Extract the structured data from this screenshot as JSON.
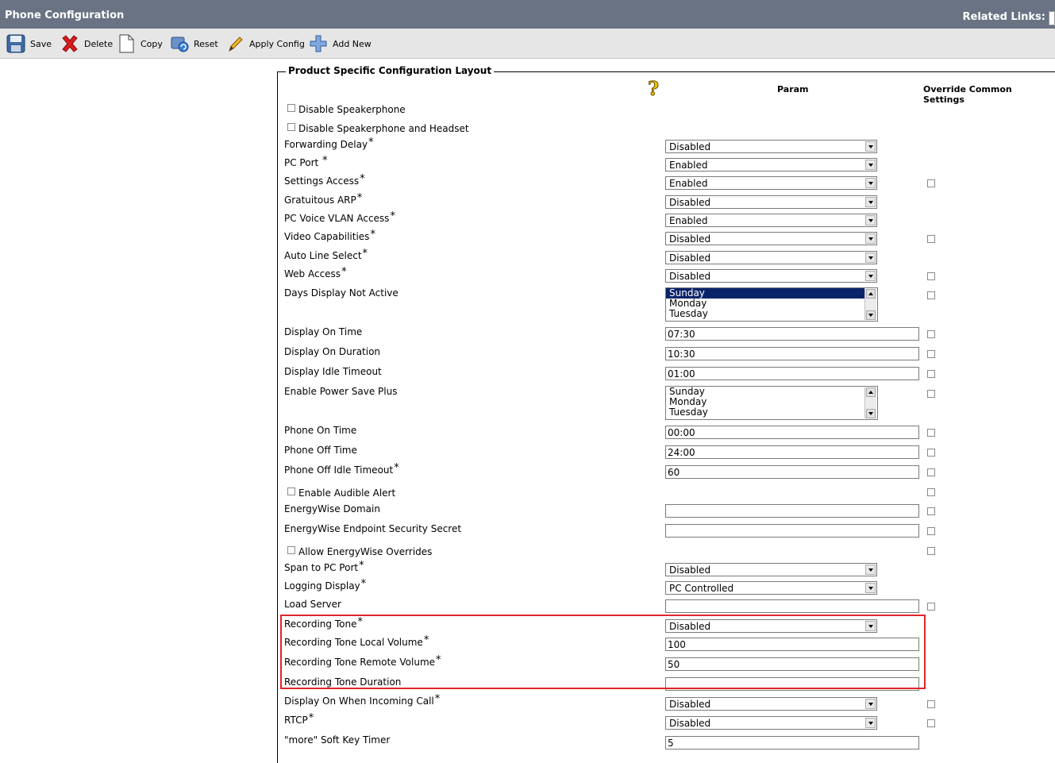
{
  "window": {
    "title": "Phone Configuration",
    "related_links": "Related Links:"
  },
  "toolbar": {
    "save": "Save",
    "delete": "Delete",
    "copy": "Copy",
    "reset": "Reset",
    "apply_config": "Apply Config",
    "add_new": "Add New"
  },
  "section": {
    "title": "Product Specific Configuration Layout",
    "help_glyph": "?",
    "param_header": "Param",
    "override_header": "Override Common Settings"
  },
  "fields": {
    "disable_speakerphone": {
      "label": "Disable Speakerphone"
    },
    "disable_speakerphone_headset": {
      "label": "Disable Speakerphone and Headset"
    },
    "forwarding_delay": {
      "label": "Forwarding Delay",
      "value": "Disabled"
    },
    "pc_port": {
      "label": "PC Port ",
      "value": "Enabled"
    },
    "settings_access": {
      "label": "Settings Access",
      "value": "Enabled"
    },
    "gratuitous_arp": {
      "label": "Gratuitous ARP",
      "value": "Disabled"
    },
    "pc_voice_vlan": {
      "label": "PC Voice VLAN Access",
      "value": "Enabled"
    },
    "video_capabilities": {
      "label": "Video Capabilities",
      "value": "Disabled"
    },
    "auto_line_select": {
      "label": "Auto Line Select",
      "value": "Disabled"
    },
    "web_access": {
      "label": "Web Access",
      "value": "Disabled"
    },
    "days_display_not_active": {
      "label": "Days Display Not Active",
      "options": [
        "Sunday",
        "Monday",
        "Tuesday"
      ],
      "selected": "Sunday"
    },
    "display_on_time": {
      "label": "Display On Time",
      "value": "07:30"
    },
    "display_on_duration": {
      "label": "Display On Duration",
      "value": "10:30"
    },
    "display_idle_timeout": {
      "label": "Display Idle Timeout",
      "value": "01:00"
    },
    "enable_power_save_plus": {
      "label": "Enable Power Save Plus",
      "options": [
        "Sunday",
        "Monday",
        "Tuesday"
      ]
    },
    "phone_on_time": {
      "label": "Phone On Time",
      "value": "00:00"
    },
    "phone_off_time": {
      "label": "Phone Off Time",
      "value": "24:00"
    },
    "phone_off_idle_timeout": {
      "label": "Phone Off Idle Timeout",
      "value": "60"
    },
    "enable_audible_alert": {
      "label": "Enable Audible Alert"
    },
    "energywise_domain": {
      "label": "EnergyWise Domain",
      "value": ""
    },
    "energywise_secret": {
      "label": "EnergyWise Endpoint Security Secret",
      "value": ""
    },
    "allow_energywise_overrides": {
      "label": "Allow EnergyWise Overrides"
    },
    "span_to_pc_port": {
      "label": "Span to PC Port",
      "value": "Disabled"
    },
    "logging_display": {
      "label": "Logging Display",
      "value": "PC Controlled"
    },
    "load_server": {
      "label": "Load Server",
      "value": ""
    },
    "recording_tone": {
      "label": "Recording Tone",
      "value": "Disabled"
    },
    "recording_tone_local_volume": {
      "label": "Recording Tone Local Volume",
      "value": "100"
    },
    "recording_tone_remote_volume": {
      "label": "Recording Tone Remote Volume",
      "value": "50"
    },
    "recording_tone_duration": {
      "label": "Recording Tone Duration",
      "value": ""
    },
    "display_on_incoming_call": {
      "label": "Display On When Incoming Call",
      "value": "Disabled"
    },
    "rtcp": {
      "label": "RTCP",
      "value": "Disabled"
    },
    "more_soft_key_timer": {
      "label": "\"more\" Soft Key Timer",
      "value": "5"
    }
  },
  "required_marker": "*",
  "colors": {
    "titlebar": "#6a7384",
    "toolbar": "#e6e6e6",
    "highlight": "#e0252b",
    "selected_option": "#0a246a"
  }
}
